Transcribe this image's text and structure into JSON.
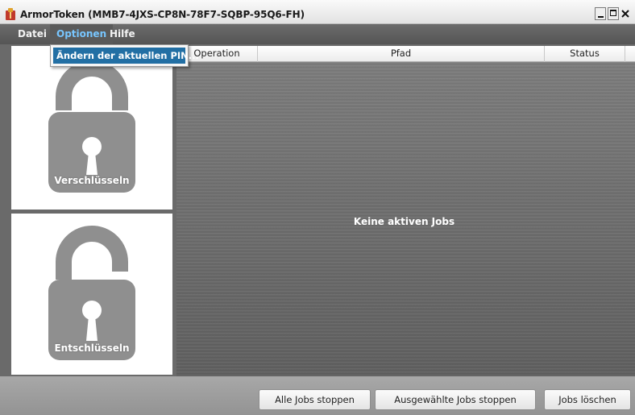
{
  "window": {
    "title": "ArmorToken (MMB7-4JXS-CP8N-78F7-SQBP-95Q6-FH)"
  },
  "menubar": {
    "items": [
      {
        "label": "Datei"
      },
      {
        "label": "Optionen"
      },
      {
        "label": "Hilfe"
      }
    ]
  },
  "optionen_menu": {
    "items": [
      {
        "label": "Ändern der aktuellen PIN..."
      }
    ]
  },
  "panels": {
    "encrypt_label": "Verschlüsseln",
    "decrypt_label": "Entschlüsseln"
  },
  "jobs_table": {
    "columns": [
      "Operation",
      "Pfad",
      "Status"
    ],
    "empty_message": "Keine aktiven Jobs"
  },
  "actions": {
    "stop_all": "Alle Jobs stoppen",
    "stop_selected": "Ausgewählte Jobs stoppen",
    "delete_jobs": "Jobs löschen"
  },
  "colors": {
    "menu_highlight": "#78c6ff",
    "selection_blue": "#226fa4",
    "lock_gray": "#8f8f8f"
  }
}
